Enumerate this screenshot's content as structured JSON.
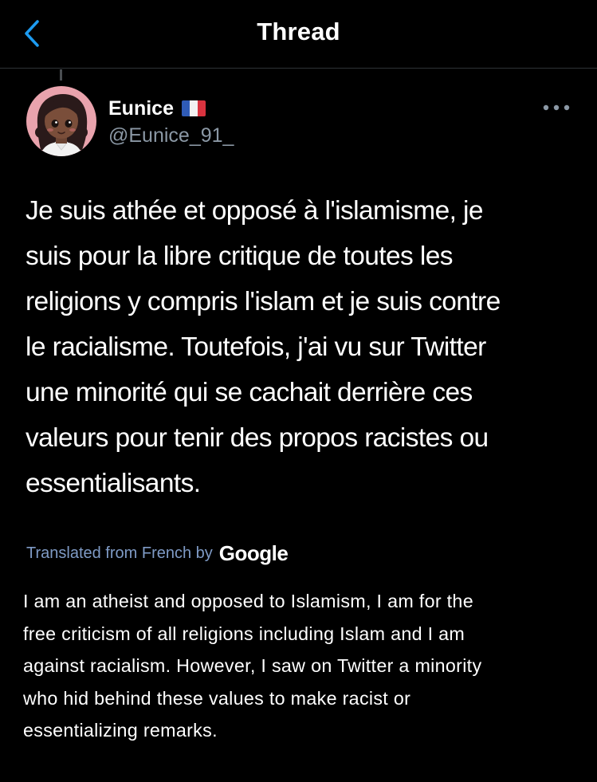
{
  "header": {
    "title": "Thread",
    "back_icon": "chevron-left-icon"
  },
  "colors": {
    "background": "#000000",
    "accent": "#1d9bf0",
    "secondary_text": "#8b98a5",
    "translation_link": "#7f9bc6",
    "divider": "#2f3336"
  },
  "tweet": {
    "author": {
      "display_name": "Eunice",
      "name_badge": "france-flag-icon",
      "handle": "@Eunice_91_",
      "avatar": "cartoon-avatar"
    },
    "more_icon": "more-horizontal-icon",
    "text": "Je suis athée et opposé à l'islamisme, je\nsuis pour la libre critique de toutes les\nreligions y compris l'islam et je suis contre\nle racialisme. Toutefois, j'ai vu sur Twitter\nune minorité qui se cachait derrière ces\nvaleurs pour tenir des propos racistes ou\nessentialisants.",
    "translation": {
      "label": "Translated from French by",
      "provider": "Google",
      "text": "I am an atheist and opposed to Islamism, I am for the\nfree criticism of all religions including Islam and I am\nagainst racialism. However, I saw on Twitter a minority\nwho hid behind these values to make racist or\nessentializing remarks."
    }
  }
}
